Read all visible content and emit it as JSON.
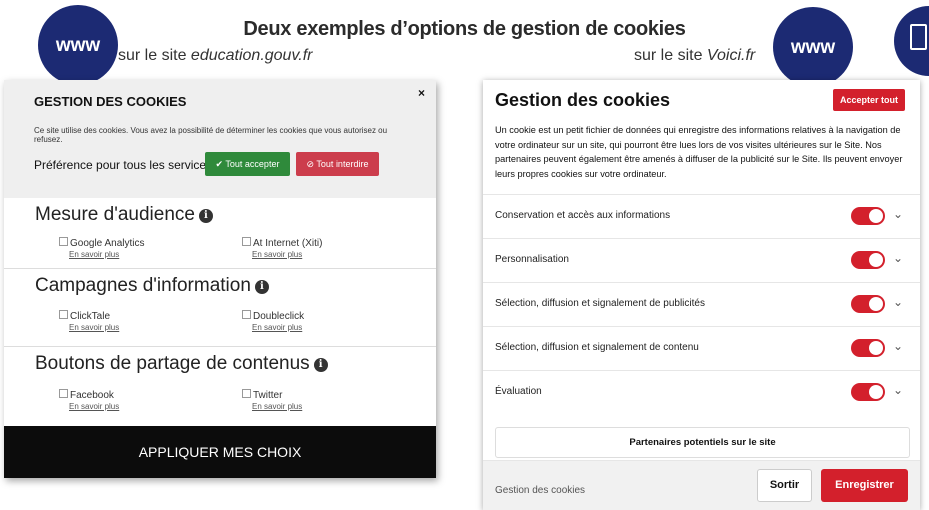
{
  "header": {
    "title": "Deux exemples d’options de gestion de cookies",
    "left_caption_prefix": "sur le site ",
    "left_caption_site": "education.gouv.fr",
    "right_caption_prefix": "sur le site ",
    "right_caption_site": "Voici.fr",
    "www_label": "www",
    "brand_color": "#1c2a73"
  },
  "left_panel": {
    "close": "×",
    "title": "GESTION DES COOKIES",
    "description": "Ce site utilise des cookies. Vous avez la possibilité de déterminer les cookies que vous autorisez ou refusez.",
    "preference_label": "Préférence pour tous les services",
    "accept_all": "✔ Tout accepter",
    "deny_all": "⊘ Tout interdire",
    "learn_more": "En savoir plus",
    "sections": [
      {
        "title": "Mesure d'audience",
        "options": [
          "Google Analytics",
          "At Internet (Xiti)"
        ]
      },
      {
        "title": "Campagnes d'information",
        "options": [
          "ClickTale",
          "Doubleclick"
        ]
      },
      {
        "title": "Boutons de partage de contenus",
        "options": [
          "Facebook",
          "Twitter"
        ]
      }
    ],
    "apply": "APPLIQUER MES CHOIX",
    "colors": {
      "accept": "#2f8a3b",
      "deny": "#cc3d4c",
      "apply_bg": "#0c0c0c"
    }
  },
  "right_panel": {
    "title": "Gestion des cookies",
    "accept_all": "Accepter tout",
    "description": "Un cookie est un petit fichier de données qui enregistre des informations relatives à la navigation de votre ordinateur sur un site, qui pourront être lues lors de vos visites ultérieures sur le Site. Nos partenaires peuvent également être amenés à diffuser de la publicité sur le Site. Ils peuvent envoyer leurs propres cookies sur votre ordinateur.",
    "rows": [
      {
        "label": "Conservation et accès aux informations",
        "enabled": true
      },
      {
        "label": "Personnalisation",
        "enabled": true
      },
      {
        "label": "Sélection, diffusion et signalement de publicités",
        "enabled": true
      },
      {
        "label": "Sélection, diffusion et signalement de contenu",
        "enabled": true
      },
      {
        "label": "Évaluation",
        "enabled": true
      }
    ],
    "partners": "Partenaires potentiels sur le site",
    "footer_label": "Gestion des cookies",
    "quit": "Sortir",
    "save": "Enregistrer",
    "accent": "#d3202c"
  }
}
